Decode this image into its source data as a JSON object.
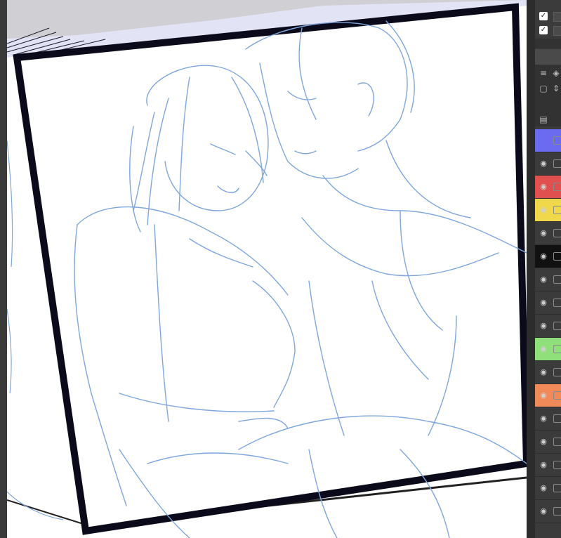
{
  "app": {
    "left_strip": "canvas-left-edge"
  },
  "panel": {
    "checks": [
      {
        "checked": true,
        "mark": "✓"
      },
      {
        "checked": true,
        "mark": "✓"
      }
    ],
    "icons": {
      "menu": "≡",
      "layers": "◈",
      "rect": "▢",
      "stepper": "⇕",
      "template": "▤"
    },
    "eye": "👁",
    "layers": [
      {
        "color": "#6b6bf0",
        "eye": false
      },
      {
        "color": "#3b3b3b",
        "eye": true
      },
      {
        "color": "#e0504e",
        "eye": true
      },
      {
        "color": "#f0d84a",
        "eye": true
      },
      {
        "color": "#3b3b3b",
        "eye": true
      },
      {
        "color": "#111111",
        "eye": true
      },
      {
        "color": "#3b3b3b",
        "eye": true
      },
      {
        "color": "#3b3b3b",
        "eye": true
      },
      {
        "color": "#3b3b3b",
        "eye": true
      },
      {
        "color": "#8fe07a",
        "eye": true
      },
      {
        "color": "#3b3b3b",
        "eye": true
      },
      {
        "color": "#f08a58",
        "eye": true
      },
      {
        "color": "#3b3b3b",
        "eye": true
      },
      {
        "color": "#3b3b3b",
        "eye": true
      },
      {
        "color": "#3b3b3b",
        "eye": true
      },
      {
        "color": "#3b3b3b",
        "eye": true
      },
      {
        "color": "#3b3b3b",
        "eye": true
      }
    ]
  },
  "canvas": {
    "sketch_color": "#7ea6dc",
    "border_color": "#0a0a1a",
    "backdrop_color": "#e3e3f6"
  }
}
